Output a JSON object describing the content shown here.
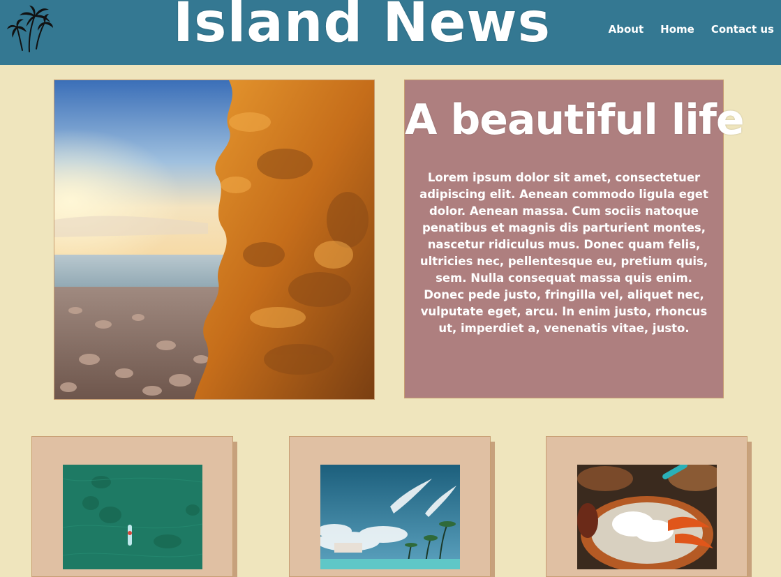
{
  "header": {
    "title": "Island News",
    "logo_icon": "palm-trees-icon",
    "nav": [
      {
        "label": "About"
      },
      {
        "label": "Home"
      },
      {
        "label": "Contact us"
      }
    ]
  },
  "hero": {
    "image_icon": "rocky-beach-sunset-photo",
    "heading": "A beautiful life",
    "body": "Lorem ipsum dolor sit amet, consectetuer adipiscing elit. Aenean commodo ligula eget dolor. Aenean massa. Cum sociis natoque penatibus et magnis dis parturient montes, nascetur ridiculus mus. Donec quam felis, ultricies nec, pellentesque eu, pretium quis, sem. Nulla consequat massa quis enim. Donec pede justo, fringilla vel, aliquet nec, vulputate eget, arcu. In enim justo, rhoncus ut, imperdiet a, venenatis vitae, justo."
  },
  "cards": [
    {
      "image_icon": "paddleboard-ocean-photo"
    },
    {
      "image_icon": "tropical-beach-photo"
    },
    {
      "image_icon": "food-plate-photo"
    }
  ],
  "colors": {
    "background": "#efe5bd",
    "header": "#347892",
    "hero_text_bg": "#ae7f7f",
    "card_bg": "#e0c0a3",
    "card_border": "#c79e72"
  }
}
